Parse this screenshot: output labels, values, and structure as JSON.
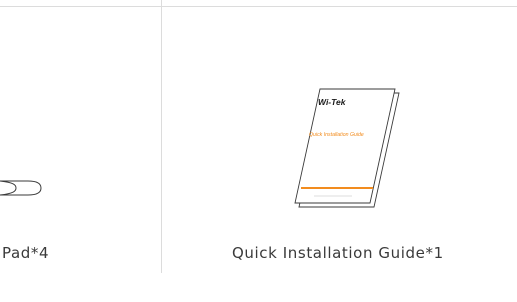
{
  "items": [
    {
      "caption": "Pad*4"
    },
    {
      "caption": "Quick Installation Guide*1",
      "booklet": {
        "brand": "Wi-Tek",
        "title": "Quick Installation Guide"
      }
    }
  ],
  "colors": {
    "accent": "#f28c1e",
    "line": "#dcdcdc",
    "text": "#3a3a3a"
  }
}
